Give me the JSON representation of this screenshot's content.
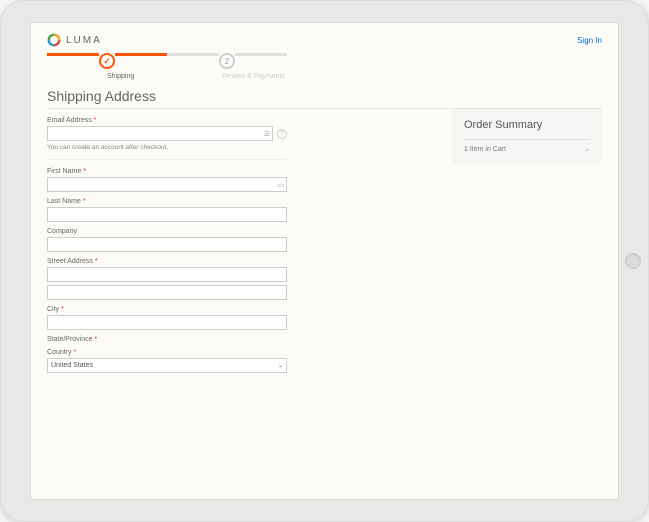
{
  "brand": {
    "name": "LUMA"
  },
  "header": {
    "sign_in": "Sign In"
  },
  "progress": {
    "step1": {
      "label": "Shipping"
    },
    "step2": {
      "num": "2",
      "label": "Review & Payments"
    }
  },
  "page": {
    "title": "Shipping Address"
  },
  "form": {
    "email": {
      "label": "Email Address",
      "hint": "You can create an account after checkout."
    },
    "first_name": {
      "label": "First Name"
    },
    "last_name": {
      "label": "Last Name"
    },
    "company": {
      "label": "Company"
    },
    "street": {
      "label": "Street Address"
    },
    "city": {
      "label": "City"
    },
    "state": {
      "label": "State/Province"
    },
    "country": {
      "label": "Country",
      "value": "United States"
    }
  },
  "summary": {
    "title": "Order Summary",
    "items_label": "1 Item in Cart"
  }
}
